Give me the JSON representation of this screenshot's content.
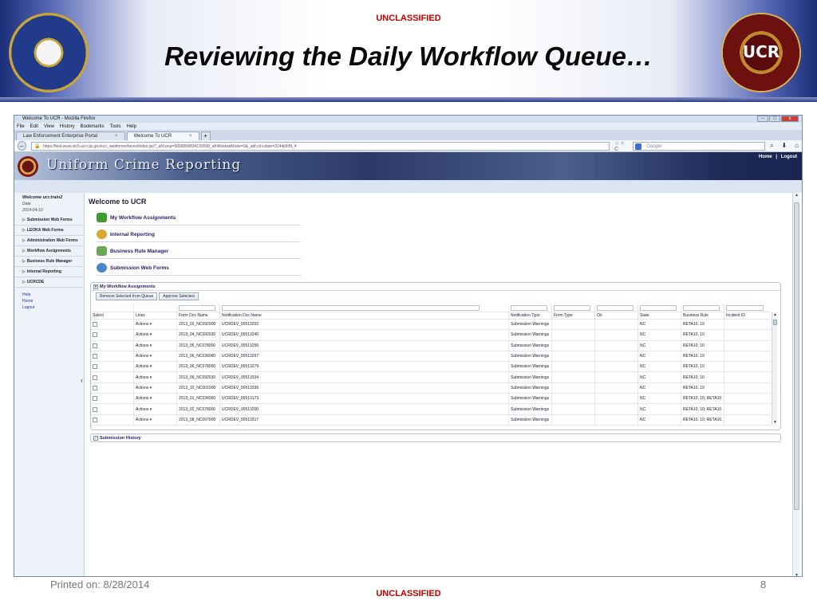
{
  "slide": {
    "classification_top": "UNCLASSIFIED",
    "title": "Reviewing the Daily Workflow Queue…",
    "classification_bottom": "UNCLASSIFIED",
    "printed_on": "Printed on:  8/28/2014",
    "page_number": "8",
    "right_seal_text": "UCR"
  },
  "browser": {
    "window_title": "Welcome To UCR - Mozilla Firefox",
    "menu": [
      "File",
      "Edit",
      "View",
      "History",
      "Bookmarks",
      "Tools",
      "Help"
    ],
    "tabs": [
      {
        "label": "Law Enforcement Enterprise Portal",
        "active": false
      },
      {
        "label": "Welcome To UCR",
        "active": true
      }
    ],
    "url": "https://test.www.stc5.ucr.cjis.gov/ucr_webforms/faces/index.jsp?_afrLoop=5068009834130008_afrWindowMode=0&_adf.ctrl-state=3144j0hf9_4",
    "search_placeholder": "Google"
  },
  "ucr_app": {
    "header_title": "Uniform Crime Reporting",
    "header_links": [
      "Home",
      "|",
      "Logout"
    ],
    "sidebar": {
      "welcome": "Welcome ucr.train2",
      "date_label": "Date",
      "date_value": "2014-04-10",
      "items": [
        "Submission Web Forms",
        "LEOKA Web Forms",
        "Administration Web Forms",
        "Workflow Assignments",
        "Business Rule Manager",
        "Internal Reporting",
        "UCRCDE"
      ],
      "links": [
        "Help",
        "Home",
        "Logout"
      ]
    },
    "main": {
      "heading": "Welcome to UCR",
      "quick_links": [
        {
          "label": "My Workflow Assignments",
          "icon": "arrow-icon",
          "color": "#3d9b2f"
        },
        {
          "label": "Internal Reporting",
          "icon": "lightbulb-icon",
          "color": "#d9a832"
        },
        {
          "label": "Business Rule Manager",
          "icon": "chart-icon",
          "color": "#6aa84f"
        },
        {
          "label": "Submission Web Forms",
          "icon": "globe-icon",
          "color": "#4a86c8"
        }
      ],
      "workflow_panel": {
        "title": "My Workflow Assignments",
        "buttons": [
          "Remove Selected from Queue",
          "Approve Selected"
        ],
        "columns": [
          "Select",
          "Links",
          "Form Doc Name",
          "Notification Doc Name",
          "Notification Type",
          "Form Type",
          "Ori",
          "State",
          "Business Rule",
          "Incident ID"
        ],
        "rows": [
          [
            "Actions ▾",
            "2013_02_NC092000",
            "UCRDEV_00513202",
            "Submission Warnings",
            "NC",
            "RETA10. 10"
          ],
          [
            "Actions ▾",
            "2013_04_NC092030",
            "UCRDEV_00513240",
            "Submission Warnings",
            "NC",
            "RETA10. 10"
          ],
          [
            "Actions ▾",
            "2013_05_NC078000",
            "UCRDEV_00513256",
            "Submission Warnings",
            "NC",
            "RETA10. 10"
          ],
          [
            "Actions ▾",
            "2013_06_NC036060",
            "UCRDEV_00513267",
            "Submission Warnings",
            "NC",
            "RETA10. 10"
          ],
          [
            "Actions ▾",
            "2013_06_NC078000",
            "UCRDEV_00513279",
            "Submission Warnings",
            "NC",
            "RETA10. 10"
          ],
          [
            "Actions ▾",
            "2013_09_NC092030",
            "UCRDEV_00513334",
            "Submission Warnings",
            "NC",
            "RETA10. 10"
          ],
          [
            "Actions ▾",
            "2013_10_NC001000",
            "UCRDEV_00513336",
            "Submission Warnings",
            "NC",
            "RETA10. 10"
          ],
          [
            "Actions ▾",
            "2013_01_NC036060",
            "UCRDEV_00513173",
            "Submission Warnings",
            "NC",
            "RETA10. 10; RETA10."
          ],
          [
            "Actions ▾",
            "2013_02_NC078000",
            "UCRDEV_00513200",
            "Submission Warnings",
            "NC",
            "RETA10. 10; RETA10."
          ],
          [
            "Actions ▾",
            "2013_08_NC097000",
            "UCRDEV_00513317",
            "Submission Warnings",
            "NC",
            "RETA10. 10; RETA10."
          ]
        ]
      },
      "history_panel": {
        "title": "Submission History"
      }
    }
  },
  "colors": {
    "classification": "#c00000",
    "link": "#2b1a6b",
    "header_bg": "#2c3a66"
  }
}
